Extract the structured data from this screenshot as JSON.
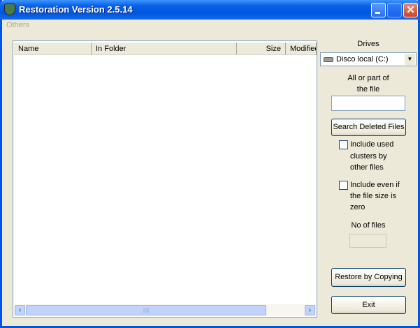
{
  "window": {
    "title": "Restoration Version 2.5.14"
  },
  "menu": {
    "others": "Others"
  },
  "list": {
    "columns": [
      "Name",
      "In Folder",
      "Size",
      "Modified"
    ],
    "rows": []
  },
  "panel": {
    "drives_label": "Drives",
    "drive_selected": "Disco local (C:)",
    "file_label_1": "All or part of",
    "file_label_2": "the file",
    "file_value": "",
    "search_button": "Search Deleted Files",
    "include_used": [
      "Include used",
      "clusters by",
      "other files"
    ],
    "include_zero": [
      "Include even if",
      "the file size is",
      "zero"
    ],
    "no_files_label": "No of files",
    "no_files_value": "",
    "restore_button": "Restore by Copying",
    "exit_button": "Exit"
  }
}
